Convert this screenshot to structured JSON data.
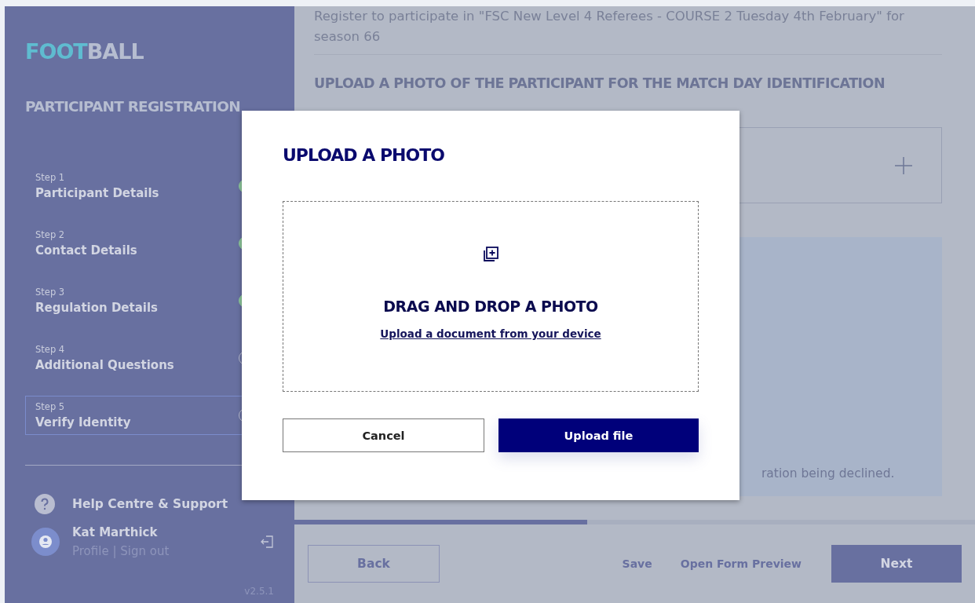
{
  "sidebar": {
    "logo": {
      "part_1": "FOOT",
      "part_2": "BALL"
    },
    "title": "PARTICIPANT REGISTRATION",
    "steps": [
      {
        "step": "Step 1",
        "label": "Participant Details",
        "completed": true,
        "selected": false
      },
      {
        "step": "Step 2",
        "label": "Contact Details",
        "completed": true,
        "selected": false
      },
      {
        "step": "Step 3",
        "label": "Regulation Details",
        "completed": true,
        "selected": false
      },
      {
        "step": "Step 4",
        "label": "Additional Questions",
        "completed": false,
        "selected": false
      },
      {
        "step": "Step 5",
        "label": "Verify Identity",
        "completed": false,
        "selected": true
      }
    ],
    "help": "Help Centre & Support",
    "user": {
      "name": "Kat Marthick",
      "links": "Profile | Sign out"
    },
    "version": "v2.5.1"
  },
  "main": {
    "intro": "Register to participate in \"FSC New Level 4 Referees - COURSE 2 Tuesday 4th February\" for season 66",
    "heading": "UPLOAD A PHOTO OF THE PARTICIPANT FOR THE MATCH DAY IDENTIFICATION",
    "notice": "ration being declined.",
    "progress": {
      "level": 0.43
    }
  },
  "footer": {
    "back": "Back",
    "save": "Save",
    "preview": "Open Form Preview",
    "next": "Next"
  },
  "modal": {
    "title": "UPLOAD A PHOTO",
    "drop_title": "DRAG AND DROP A PHOTO",
    "drop_link": "Upload a document from your device",
    "cancel": "Cancel",
    "confirm": "Upload file"
  }
}
